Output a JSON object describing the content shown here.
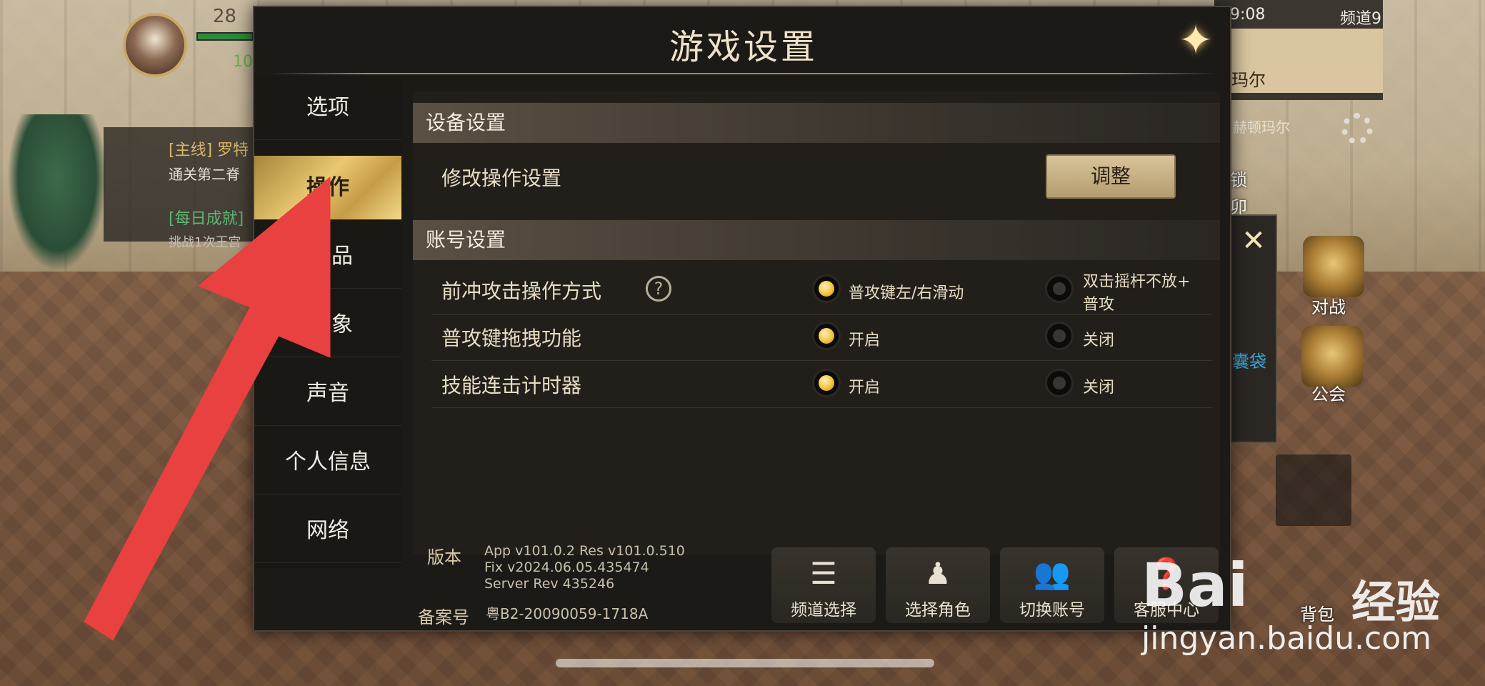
{
  "hud": {
    "level": "28",
    "resource": "10",
    "quest1": "[主线] 罗特",
    "quest1_desc": "通关第二脊",
    "quest2": "[每日成就]",
    "quest2_desc": "挑战1次王宫",
    "time": "9:08",
    "channel": "频道9",
    "map_name": "玛尔",
    "map_subtitle": "赫顿玛尔",
    "right_link": "囊袋",
    "battle_label": "对战",
    "guild_label": "公会",
    "bag_label": "背包",
    "side_text1": "锁",
    "side_text2": "卯"
  },
  "dialog": {
    "title": "游戏设置",
    "close_icon": "close-icon",
    "tabs": [
      "选项",
      "操作",
      "品",
      "象",
      "声音",
      "个人信息",
      "网络"
    ],
    "active_tab": "操作",
    "device_section": "设备设置",
    "modify_control": "修改操作设置",
    "adjust_button": "调整",
    "account_section": "账号设置",
    "rows": [
      {
        "label": "前冲攻击操作方式",
        "opt1": "普攻键左/右滑动",
        "opt2_line1": "双击摇杆不放+",
        "opt2_line2": "普攻",
        "selected": 1
      },
      {
        "label": "普攻键拖拽功能",
        "opt1": "开启",
        "opt2": "关闭",
        "selected": 1
      },
      {
        "label": "技能连击计时器",
        "opt1": "开启",
        "opt2": "关闭",
        "selected": 1
      }
    ],
    "version_label": "版本",
    "version_line1": "App v101.0.2 Res v101.0.510",
    "version_line2": "Fix v2024.06.05.435474",
    "version_line3": "Server Rev 435246",
    "record_label": "备案号",
    "record_value": "粤B2-20090059-1718A",
    "footer_buttons": [
      {
        "label": "频道选择",
        "icon": "list-icon"
      },
      {
        "label": "选择角色",
        "icon": "character-icon"
      },
      {
        "label": "切换账号",
        "icon": "users-icon"
      },
      {
        "label": "客服中心",
        "icon": "support-icon"
      }
    ]
  },
  "watermark": {
    "brand": "Bai",
    "suffix": "经验",
    "url": "jingyan.baidu.com"
  },
  "colors": {
    "accent_gold": "#e9c870",
    "arrow_red": "#e8413f",
    "dialog_bg": "#1c1a17"
  }
}
